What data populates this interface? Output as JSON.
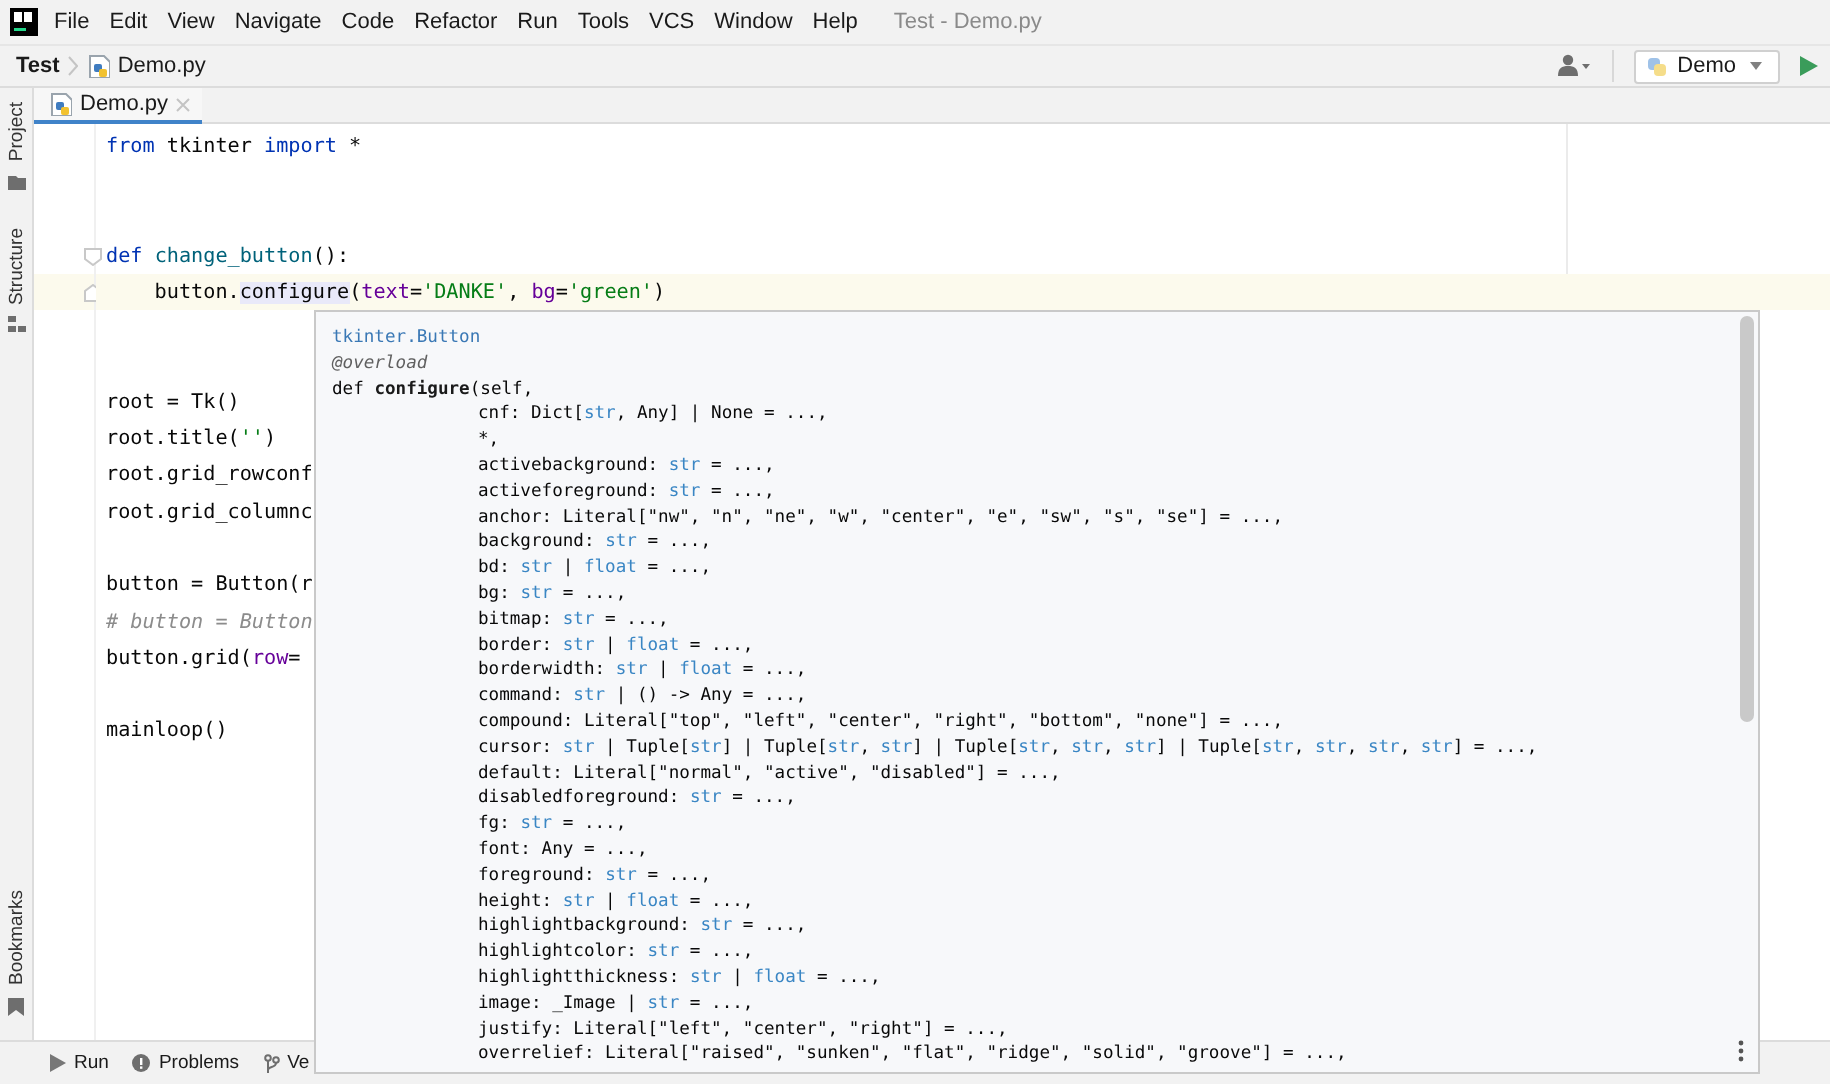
{
  "window": {
    "title": "Test - Demo.py"
  },
  "menu": [
    "File",
    "Edit",
    "View",
    "Navigate",
    "Code",
    "Refactor",
    "Run",
    "Tools",
    "VCS",
    "Window",
    "Help"
  ],
  "navbar": {
    "breadcrumbs": [
      {
        "label": "Test",
        "kind": "project"
      },
      {
        "label": "Demo.py",
        "kind": "file"
      }
    ],
    "run_config": "Demo"
  },
  "tabs": [
    {
      "label": "Demo.py",
      "selected": true
    }
  ],
  "tool_windows": {
    "left": [
      {
        "label": "Project",
        "kind": "folder"
      },
      {
        "label": "Structure",
        "kind": "structure"
      }
    ],
    "left_bottom": [
      {
        "label": "Bookmarks",
        "kind": "bookmark"
      }
    ],
    "bottom": [
      {
        "label": "Run",
        "kind": "run"
      },
      {
        "label": "Problems",
        "kind": "problems"
      },
      {
        "label": "Ve",
        "kind": "vcs"
      }
    ]
  },
  "editor": {
    "lines": [
      {
        "current": false,
        "tokens": [
          {
            "kind": "keyword",
            "text": "from"
          },
          {
            "kind": "plain",
            "text": " tkinter "
          },
          {
            "kind": "keyword",
            "text": "import"
          },
          {
            "kind": "plain",
            "text": " *"
          }
        ]
      },
      {
        "current": false
      },
      {
        "current": false
      },
      {
        "current": false,
        "fold": true,
        "tokens": [
          {
            "kind": "keyword",
            "text": "def "
          },
          {
            "kind": "fn",
            "text": "change_button"
          },
          {
            "kind": "plain",
            "text": "():"
          }
        ]
      },
      {
        "current": true,
        "fold_end": true,
        "tokens": [
          {
            "kind": "plain",
            "text": "    button."
          },
          {
            "kind": "usage",
            "text": "configure"
          },
          {
            "kind": "plain",
            "text": "("
          },
          {
            "kind": "param",
            "text": "text"
          },
          {
            "kind": "plain",
            "text": "="
          },
          {
            "kind": "string",
            "text": "'DANKE'"
          },
          {
            "kind": "plain",
            "text": ", "
          },
          {
            "kind": "param",
            "text": "bg"
          },
          {
            "kind": "plain",
            "text": "="
          },
          {
            "kind": "string",
            "text": "'green'"
          },
          {
            "kind": "plain",
            "text": ")"
          }
        ]
      },
      {
        "current": false
      },
      {
        "current": false
      },
      {
        "current": false,
        "tokens": [
          {
            "kind": "plain",
            "text": "root = Tk()"
          }
        ]
      },
      {
        "current": false,
        "tokens": [
          {
            "kind": "plain",
            "text": "root.title("
          },
          {
            "kind": "string",
            "text": "''"
          },
          {
            "kind": "plain",
            "text": ")"
          }
        ]
      },
      {
        "current": false,
        "tokens": [
          {
            "kind": "plain",
            "text": "root.grid_rowconf"
          }
        ]
      },
      {
        "current": false,
        "tokens": [
          {
            "kind": "plain",
            "text": "root.grid_columnc"
          }
        ]
      },
      {
        "current": false
      },
      {
        "current": false,
        "tokens": [
          {
            "kind": "plain",
            "text": "button = Button(r"
          }
        ]
      },
      {
        "current": false,
        "tokens": [
          {
            "kind": "comment",
            "text": "# button = Button"
          }
        ]
      },
      {
        "current": false,
        "tokens": [
          {
            "kind": "plain",
            "text": "button.grid("
          },
          {
            "kind": "param",
            "text": "row"
          },
          {
            "kind": "plain",
            "text": "="
          }
        ]
      },
      {
        "current": false
      },
      {
        "current": false,
        "tokens": [
          {
            "kind": "plain",
            "text": "mainloop()"
          }
        ]
      }
    ]
  },
  "popup": {
    "lines": [
      {
        "kind": "head",
        "tokens": [
          {
            "kind": "link",
            "text": "tkinter.Button"
          }
        ]
      },
      {
        "kind": "head",
        "tokens": [
          {
            "kind": "decorator",
            "text": "@overload"
          }
        ]
      },
      {
        "kind": "head",
        "tokens": [
          {
            "kind": "plain",
            "text": "def "
          },
          {
            "kind": "bold",
            "text": "configure"
          },
          {
            "kind": "plain",
            "text": "(self,"
          }
        ]
      },
      {
        "kind": "param",
        "tokens": [
          {
            "kind": "plain",
            "text": "cnf: Dict["
          },
          {
            "kind": "type",
            "text": "str"
          },
          {
            "kind": "plain",
            "text": ", Any] | None = ...,"
          }
        ]
      },
      {
        "kind": "param",
        "tokens": [
          {
            "kind": "plain",
            "text": "*,"
          }
        ]
      },
      {
        "kind": "param",
        "tokens": [
          {
            "kind": "plain",
            "text": "activebackground: "
          },
          {
            "kind": "type",
            "text": "str"
          },
          {
            "kind": "plain",
            "text": " = ...,"
          }
        ]
      },
      {
        "kind": "param",
        "tokens": [
          {
            "kind": "plain",
            "text": "activeforeground: "
          },
          {
            "kind": "type",
            "text": "str"
          },
          {
            "kind": "plain",
            "text": " = ...,"
          }
        ]
      },
      {
        "kind": "param",
        "tokens": [
          {
            "kind": "plain",
            "text": "anchor: Literal[\"nw\", \"n\", \"ne\", \"w\", \"center\", \"e\", \"sw\", \"s\", \"se\"] = ...,"
          }
        ]
      },
      {
        "kind": "param",
        "tokens": [
          {
            "kind": "plain",
            "text": "background: "
          },
          {
            "kind": "type",
            "text": "str"
          },
          {
            "kind": "plain",
            "text": " = ...,"
          }
        ]
      },
      {
        "kind": "param",
        "tokens": [
          {
            "kind": "plain",
            "text": "bd: "
          },
          {
            "kind": "type",
            "text": "str"
          },
          {
            "kind": "plain",
            "text": " | "
          },
          {
            "kind": "type",
            "text": "float"
          },
          {
            "kind": "plain",
            "text": " = ...,"
          }
        ]
      },
      {
        "kind": "param",
        "tokens": [
          {
            "kind": "plain",
            "text": "bg: "
          },
          {
            "kind": "type",
            "text": "str"
          },
          {
            "kind": "plain",
            "text": " = ...,"
          }
        ]
      },
      {
        "kind": "param",
        "tokens": [
          {
            "kind": "plain",
            "text": "bitmap: "
          },
          {
            "kind": "type",
            "text": "str"
          },
          {
            "kind": "plain",
            "text": " = ...,"
          }
        ]
      },
      {
        "kind": "param",
        "tokens": [
          {
            "kind": "plain",
            "text": "border: "
          },
          {
            "kind": "type",
            "text": "str"
          },
          {
            "kind": "plain",
            "text": " | "
          },
          {
            "kind": "type",
            "text": "float"
          },
          {
            "kind": "plain",
            "text": " = ...,"
          }
        ]
      },
      {
        "kind": "param",
        "tokens": [
          {
            "kind": "plain",
            "text": "borderwidth: "
          },
          {
            "kind": "type",
            "text": "str"
          },
          {
            "kind": "plain",
            "text": " | "
          },
          {
            "kind": "type",
            "text": "float"
          },
          {
            "kind": "plain",
            "text": " = ...,"
          }
        ]
      },
      {
        "kind": "param",
        "tokens": [
          {
            "kind": "plain",
            "text": "command: "
          },
          {
            "kind": "type",
            "text": "str"
          },
          {
            "kind": "plain",
            "text": " | () -> Any = ...,"
          }
        ]
      },
      {
        "kind": "param",
        "tokens": [
          {
            "kind": "plain",
            "text": "compound: Literal[\"top\", \"left\", \"center\", \"right\", \"bottom\", \"none\"] = ...,"
          }
        ]
      },
      {
        "kind": "param",
        "tokens": [
          {
            "kind": "plain",
            "text": "cursor: "
          },
          {
            "kind": "type",
            "text": "str"
          },
          {
            "kind": "plain",
            "text": " | Tuple["
          },
          {
            "kind": "type",
            "text": "str"
          },
          {
            "kind": "plain",
            "text": "] | Tuple["
          },
          {
            "kind": "type",
            "text": "str"
          },
          {
            "kind": "plain",
            "text": ", "
          },
          {
            "kind": "type",
            "text": "str"
          },
          {
            "kind": "plain",
            "text": "] | Tuple["
          },
          {
            "kind": "type",
            "text": "str"
          },
          {
            "kind": "plain",
            "text": ", "
          },
          {
            "kind": "type",
            "text": "str"
          },
          {
            "kind": "plain",
            "text": ", "
          },
          {
            "kind": "type",
            "text": "str"
          },
          {
            "kind": "plain",
            "text": "] | Tuple["
          },
          {
            "kind": "type",
            "text": "str"
          },
          {
            "kind": "plain",
            "text": ", "
          },
          {
            "kind": "type",
            "text": "str"
          },
          {
            "kind": "plain",
            "text": ", "
          },
          {
            "kind": "type",
            "text": "str"
          },
          {
            "kind": "plain",
            "text": ", "
          },
          {
            "kind": "type",
            "text": "str"
          },
          {
            "kind": "plain",
            "text": "] = ...,"
          }
        ]
      },
      {
        "kind": "param",
        "tokens": [
          {
            "kind": "plain",
            "text": "default: Literal[\"normal\", \"active\", \"disabled\"] = ...,"
          }
        ]
      },
      {
        "kind": "param",
        "tokens": [
          {
            "kind": "plain",
            "text": "disabledforeground: "
          },
          {
            "kind": "type",
            "text": "str"
          },
          {
            "kind": "plain",
            "text": " = ...,"
          }
        ]
      },
      {
        "kind": "param",
        "tokens": [
          {
            "kind": "plain",
            "text": "fg: "
          },
          {
            "kind": "type",
            "text": "str"
          },
          {
            "kind": "plain",
            "text": " = ...,"
          }
        ]
      },
      {
        "kind": "param",
        "tokens": [
          {
            "kind": "plain",
            "text": "font: Any = ...,"
          }
        ]
      },
      {
        "kind": "param",
        "tokens": [
          {
            "kind": "plain",
            "text": "foreground: "
          },
          {
            "kind": "type",
            "text": "str"
          },
          {
            "kind": "plain",
            "text": " = ...,"
          }
        ]
      },
      {
        "kind": "param",
        "tokens": [
          {
            "kind": "plain",
            "text": "height: "
          },
          {
            "kind": "type",
            "text": "str"
          },
          {
            "kind": "plain",
            "text": " | "
          },
          {
            "kind": "type",
            "text": "float"
          },
          {
            "kind": "plain",
            "text": " = ...,"
          }
        ]
      },
      {
        "kind": "param",
        "tokens": [
          {
            "kind": "plain",
            "text": "highlightbackground: "
          },
          {
            "kind": "type",
            "text": "str"
          },
          {
            "kind": "plain",
            "text": " = ...,"
          }
        ]
      },
      {
        "kind": "param",
        "tokens": [
          {
            "kind": "plain",
            "text": "highlightcolor: "
          },
          {
            "kind": "type",
            "text": "str"
          },
          {
            "kind": "plain",
            "text": " = ...,"
          }
        ]
      },
      {
        "kind": "param",
        "tokens": [
          {
            "kind": "plain",
            "text": "highlightthickness: "
          },
          {
            "kind": "type",
            "text": "str"
          },
          {
            "kind": "plain",
            "text": " | "
          },
          {
            "kind": "type",
            "text": "float"
          },
          {
            "kind": "plain",
            "text": " = ...,"
          }
        ]
      },
      {
        "kind": "param",
        "tokens": [
          {
            "kind": "plain",
            "text": "image: _Image | "
          },
          {
            "kind": "type",
            "text": "str"
          },
          {
            "kind": "plain",
            "text": " = ...,"
          }
        ]
      },
      {
        "kind": "param",
        "tokens": [
          {
            "kind": "plain",
            "text": "justify: Literal[\"left\", \"center\", \"right\"] = ...,"
          }
        ]
      },
      {
        "kind": "param",
        "tokens": [
          {
            "kind": "plain",
            "text": "overrelief: Literal[\"raised\", \"sunken\", \"flat\", \"ridge\", \"solid\", \"groove\"] = ...,"
          }
        ]
      }
    ]
  }
}
